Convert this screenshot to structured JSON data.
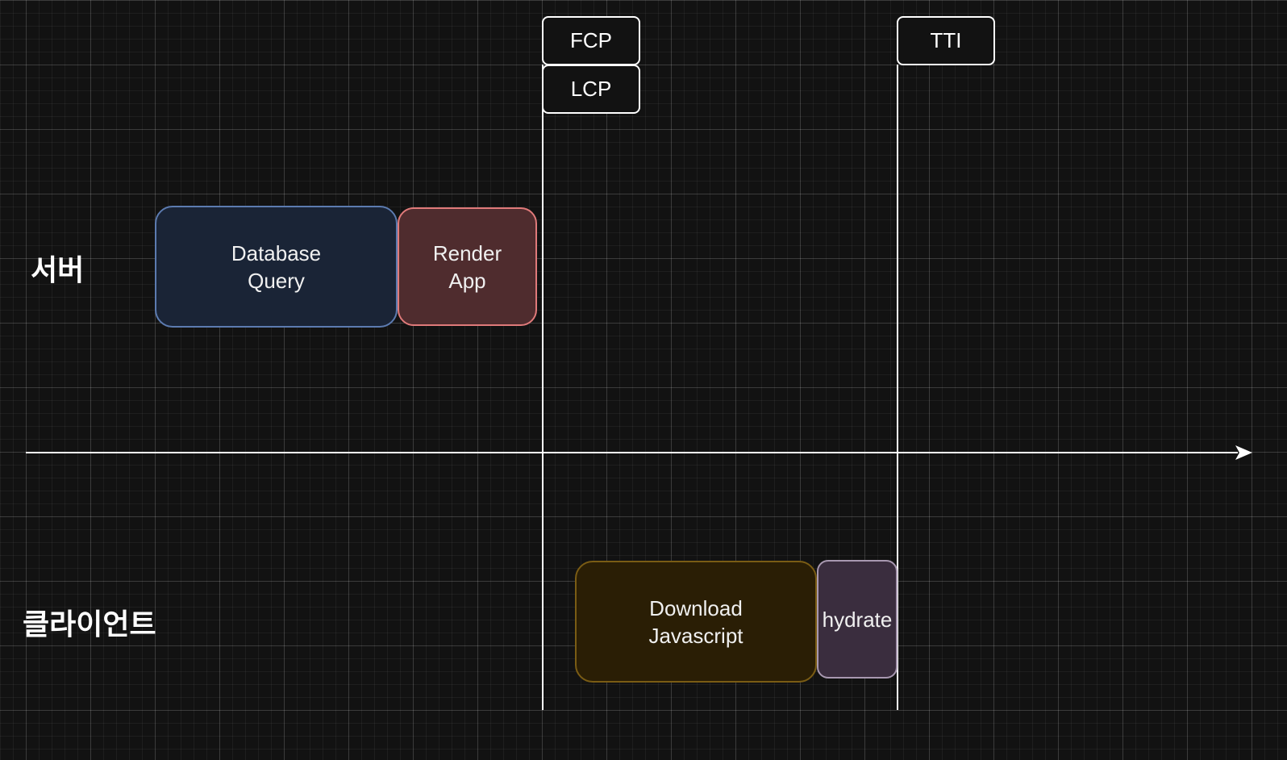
{
  "lanes": {
    "server_label": "서버",
    "client_label": "클라이언트"
  },
  "markers": {
    "fcp": "FCP",
    "lcp": "LCP",
    "tti": "TTI"
  },
  "tasks": {
    "database_query": "Database\nQuery",
    "render_app": "Render\nApp",
    "download_javascript": "Download\nJavascript",
    "hydrate": "hydrate"
  },
  "colors": {
    "background": "#121212",
    "database_fill": "#1a2436",
    "database_border": "#5c7bb0",
    "render_fill": "#4f2c2e",
    "render_border": "#e07a7a",
    "download_fill": "#2a1e05",
    "download_border": "#7a5c14",
    "hydrate_fill": "#3a2d3e",
    "hydrate_border": "#a898b0"
  }
}
